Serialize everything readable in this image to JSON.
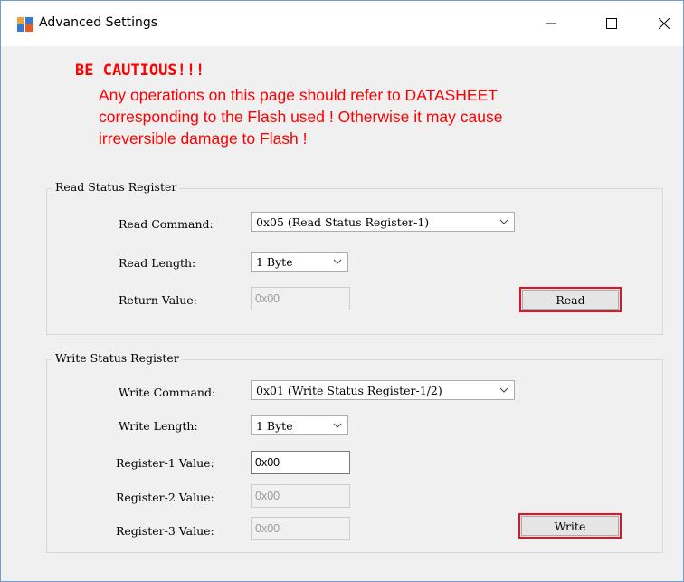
{
  "window": {
    "title": "Advanced Settings",
    "controls": [
      "minimize-icon",
      "maximize-icon",
      "close-icon"
    ]
  },
  "warning": {
    "title": "BE CAUTIOUS!!!",
    "line1": "Any operations on this page should refer to DATASHEET",
    "line2": "corresponding to the Flash used ! Otherwise it may cause",
    "line3": "irreversible damage to Flash !",
    "color": "#ff0000"
  },
  "read_group": {
    "title": "Read Status Register",
    "command_label": "Read Command:",
    "command_value": "0x05 (Read Status Register-1)",
    "length_label": "Read Length:",
    "length_value": "1 Byte",
    "return_label": "Return Value:",
    "return_value": "0x00",
    "read_button": "Read"
  },
  "write_group": {
    "title": "Write Status Register",
    "command_label": "Write Command:",
    "command_value": "0x01 (Write Status Register-1/2)",
    "length_label": "Write Length:",
    "length_value": "1 Byte",
    "reg1_label": "Register-1 Value:",
    "reg1_value": "0x00",
    "reg2_label": "Register-2 Value:",
    "reg2_value": "0x00",
    "reg3_label": "Register-3 Value:",
    "reg3_value": "0x00",
    "write_button": "Write"
  },
  "colors": {
    "button_highlight": "#e81123",
    "window_border": "#6f9ccc",
    "panel_background": "#f0f0f0"
  }
}
